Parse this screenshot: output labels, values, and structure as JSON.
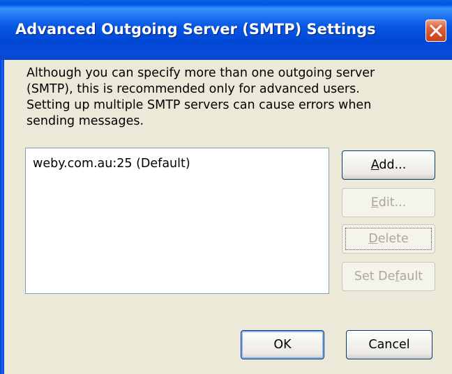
{
  "dialog": {
    "title": "Advanced Outgoing Server (SMTP) Settings",
    "close_glyph": "✕",
    "description_lines": [
      "Although you can specify more than one outgoing server",
      "(SMTP), this is recommended only for advanced users.",
      "Setting up multiple SMTP servers can cause errors when",
      "sending messages."
    ]
  },
  "server_list": {
    "items": [
      {
        "label": "weby.com.au:25 (Default)"
      }
    ]
  },
  "side_buttons": {
    "add": {
      "pre": "",
      "key": "A",
      "post": "dd...",
      "enabled": true
    },
    "edit": {
      "pre": "",
      "key": "E",
      "post": "dit...",
      "enabled": false
    },
    "delete": {
      "pre": "",
      "key": "D",
      "post": "elete",
      "enabled": false
    },
    "set_default": {
      "pre": "Set De",
      "key": "f",
      "post": "ault",
      "enabled": false
    }
  },
  "footer_buttons": {
    "ok_label": "OK",
    "cancel_label": "Cancel"
  },
  "colors": {
    "titlebar_blue": "#0058e6",
    "dialog_bg": "#ece9d8",
    "close_red": "#e0603a",
    "disabled_text": "#aca899"
  }
}
